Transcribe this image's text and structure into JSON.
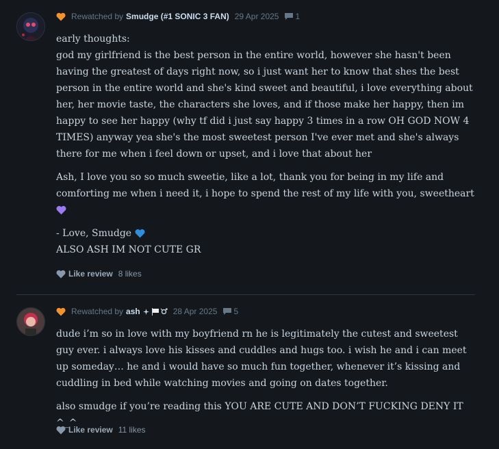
{
  "reviews": [
    {
      "action": "Rewatched by",
      "username": "Smudge (#1 SONIC 3 FAN)",
      "date": "29 Apr 2025",
      "comments": "1",
      "paragraphs": [
        "early thoughts:",
        "god my girlfriend is the best person in the entire world, however she hasn't been having the greatest of days right now, so i just want her to know that shes the best person in the entire world and she's kind sweet and beautiful, i love everything about her, her movie taste, the characters she loves, and if those make her happy, then im happy to see her happy (why tf did i just say happy 3 times in a row OH GOD NOW 4 TIMES) anyway yea she's the most sweetest person I've ever met and she's always there for me when i feel down or upset, and i love that about her",
        "Ash, I love you so so much sweetie, like a lot, thank you for being in my life and comforting me when i need it, i hope to spend the rest of my life with you, sweetheart",
        "- Love, Smudge",
        "ALSO ASH IM NOT CUTE GR"
      ],
      "like_label": "Like review",
      "likes": "8 likes",
      "heart_emoji_color": "#9b7bf0",
      "blue_heart_color": "#2d8ee0"
    },
    {
      "action": "Rewatched by",
      "username": "ash",
      "date": "28 Apr 2025",
      "comments": "5",
      "paragraphs": [
        "dude i’m so in love with my boyfriend rn he is legitimately the cutest and sweetest guy ever. i always love his kisses and cuddles and hugs too. i wish he and i can meet up someday… he and i would have so much fun together, whenever it’s kissing and cuddling in bed while watching movies and going on dates together.",
        "also smudge if you’re reading this YOU ARE CUTE AND DON’T FUCKING DENY IT ^_^"
      ],
      "like_label": "Like review",
      "likes": "11 likes"
    }
  ],
  "colors": {
    "background": "#14181c",
    "rewatch_heart": "#f5922c",
    "like_heart": "#89a"
  }
}
